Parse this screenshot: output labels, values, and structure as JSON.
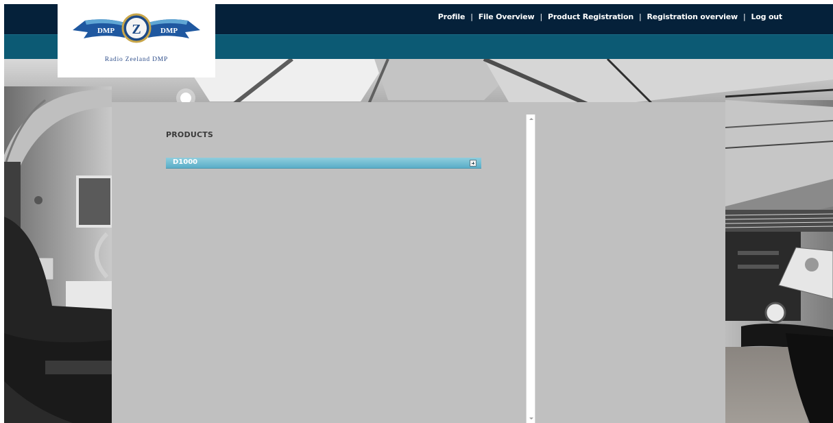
{
  "logo": {
    "left_text": "DMP",
    "center_letter": "Z",
    "right_text": "DMP",
    "caption": "Radio Zeeland DMP",
    "colors": {
      "ribbon": "#1f58a0",
      "ribbon_light": "#5fa6d4",
      "badge_fill": "#1d4a86",
      "badge_ring": "#c8a64a"
    }
  },
  "nav": {
    "items": [
      {
        "label": "Profile"
      },
      {
        "label": "File Overview"
      },
      {
        "label": "Product Registration"
      },
      {
        "label": "Registration overview"
      },
      {
        "label": "Log out"
      }
    ],
    "separator": "|"
  },
  "products": {
    "heading": "PRODUCTS",
    "items": [
      {
        "label": "D1000",
        "expand_icon": "plus-square-icon"
      }
    ]
  },
  "colors": {
    "header_dark": "#05213a",
    "header_teal": "#0c5a74",
    "panel": "#c0c0c0",
    "product_row": "#6ab8cf"
  }
}
